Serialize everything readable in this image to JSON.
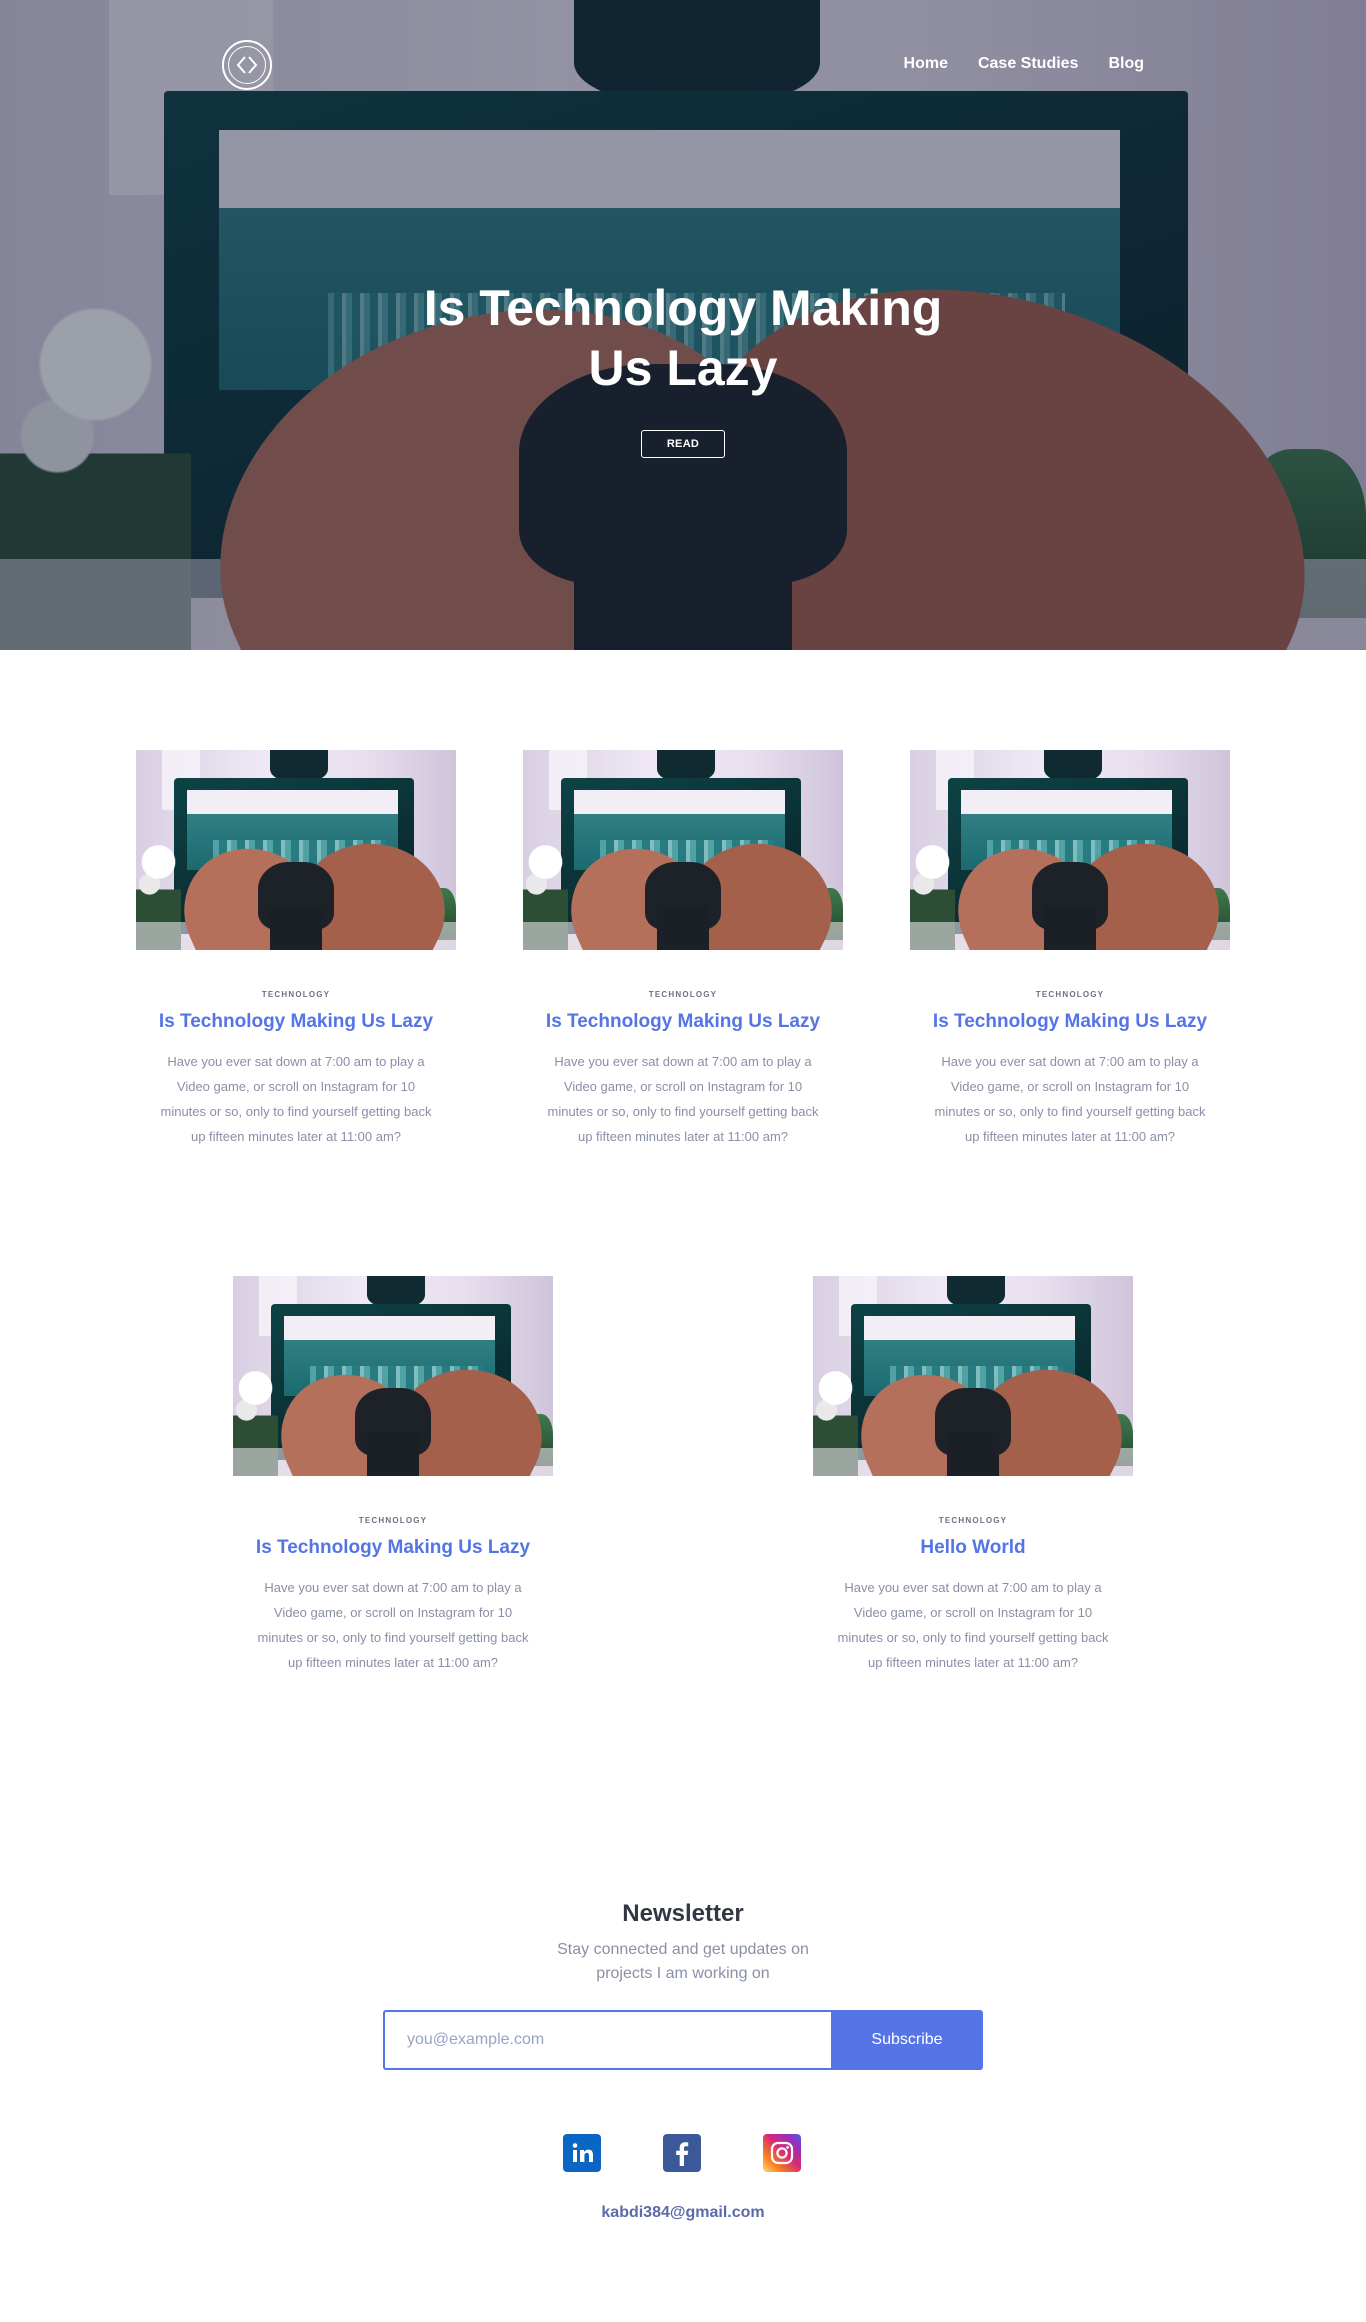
{
  "header": {
    "logo_name": "code-brackets-logo",
    "nav": [
      {
        "label": "Home"
      },
      {
        "label": "Case Studies"
      },
      {
        "label": "Blog"
      }
    ]
  },
  "hero": {
    "title": "Is Technology Making Us Lazy",
    "button_label": "READ"
  },
  "posts": [
    {
      "category": "TECHNOLOGY",
      "title": "Is Technology Making Us Lazy",
      "excerpt": "Have you ever sat down at 7:00 am to play a Video game, or scroll on Instagram for 10 minutes or so, only to find yourself getting back up fifteen minutes later at 11:00 am?"
    },
    {
      "category": "TECHNOLOGY",
      "title": "Is Technology Making Us Lazy",
      "excerpt": "Have you ever sat down at 7:00 am to play a Video game, or scroll on Instagram for 10 minutes or so, only to find yourself getting back up fifteen minutes later at 11:00 am?"
    },
    {
      "category": "TECHNOLOGY",
      "title": "Is Technology Making Us Lazy",
      "excerpt": "Have you ever sat down at 7:00 am to play a Video game, or scroll on Instagram for 10 minutes or so, only to find yourself getting back up fifteen minutes later at 11:00 am?"
    },
    {
      "category": "TECHNOLOGY",
      "title": "Is Technology Making Us Lazy",
      "excerpt": "Have you ever sat down at 7:00 am to play a Video game, or scroll on Instagram for 10 minutes or so, only to find yourself getting back up fifteen minutes later at 11:00 am?"
    },
    {
      "category": "TECHNOLOGY",
      "title": "Hello World",
      "excerpt": "Have you ever sat down at 7:00 am to play a Video game, or scroll on Instagram for 10 minutes or so, only to find yourself getting back up fifteen minutes later at 11:00 am?"
    }
  ],
  "newsletter": {
    "title": "Newsletter",
    "subtitle": "Stay connected and get updates on projects I am working on",
    "email_placeholder": "you@example.com",
    "button_label": "Subscribe"
  },
  "socials": [
    {
      "icon": "linkedin-icon",
      "color": "#0a66c2"
    },
    {
      "icon": "facebook-icon",
      "color": "#3b5998"
    },
    {
      "icon": "instagram-icon",
      "color": "#d6249f"
    }
  ],
  "footer": {
    "email": "kabdi384@gmail.com"
  },
  "colors": {
    "accent": "#5574e6",
    "text_muted": "#8a8fa8"
  }
}
